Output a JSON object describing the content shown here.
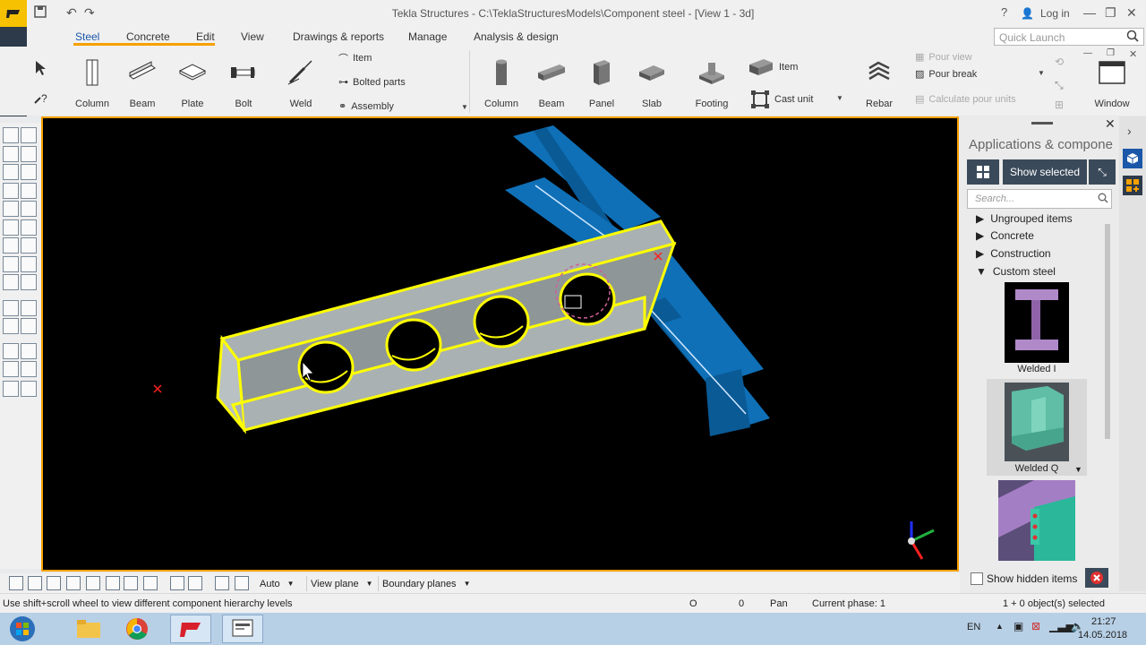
{
  "window": {
    "title": "Tekla Structures - C:\\TeklaStructuresModels\\Component steel  - [View 1 - 3d]",
    "login_label": "Log in"
  },
  "menu": {
    "tabs": [
      "Steel",
      "Concrete",
      "Edit",
      "View",
      "Drawings & reports",
      "Manage",
      "Analysis & design"
    ],
    "active_tab": "Steel"
  },
  "quick_launch": {
    "placeholder": "Quick Launch"
  },
  "ribbon": {
    "steel": {
      "buttons": [
        "Column",
        "Beam",
        "Plate",
        "Bolt",
        "Weld"
      ],
      "small": [
        "Item",
        "Bolted parts",
        "Assembly"
      ]
    },
    "concrete": {
      "buttons": [
        "Column",
        "Beam",
        "Panel",
        "Slab",
        "Footing"
      ],
      "small": [
        "Item",
        "Cast unit"
      ]
    },
    "rebar_label": "Rebar",
    "pour": {
      "pour_view": "Pour view",
      "pour_break": "Pour break",
      "calc_units": "Calculate pour units"
    },
    "window_label": "Window"
  },
  "panel": {
    "title": "Applications & compone",
    "show_selected": "Show selected",
    "search_placeholder": "Search...",
    "tree": [
      "Ungrouped items",
      "Concrete",
      "Construction",
      "Custom steel"
    ],
    "components": [
      "Welded I",
      "Welded Q"
    ],
    "show_hidden": "Show hidden items"
  },
  "bottom_tools": {
    "auto": "Auto",
    "view_plane": "View plane",
    "boundary_planes": "Boundary planes"
  },
  "status": {
    "hint": "Use shift+scroll wheel to view different component hierarchy levels",
    "o_label": "O",
    "zero": "0",
    "pan": "Pan",
    "phase": "Current phase: 1",
    "selected": "1 + 0 object(s) selected"
  },
  "taskbar": {
    "lang": "EN",
    "time": "21:27",
    "date": "14.05.2018"
  },
  "colors": {
    "accent": "#f6a000",
    "viewport_bg": "#000000",
    "selected_beam": "#ffff00",
    "beam_fill": "#a9b1b2",
    "column_blue": "#0f70b7"
  }
}
